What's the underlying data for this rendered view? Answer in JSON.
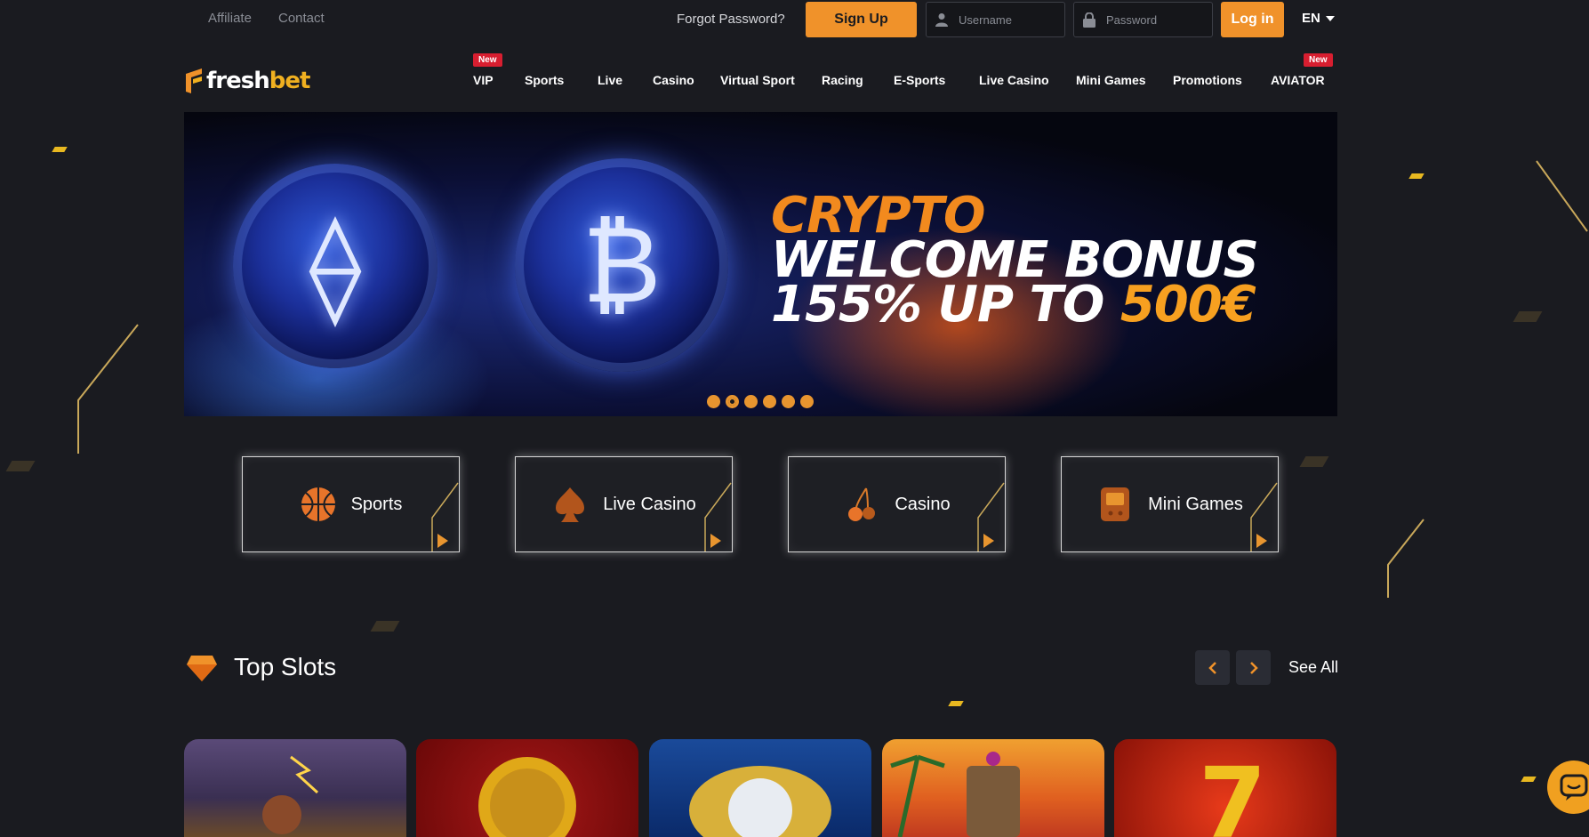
{
  "topbar": {
    "links": [
      "Affiliate",
      "Contact"
    ],
    "forgot_password": "Forgot Password?",
    "signup_label": "Sign Up",
    "username_placeholder": "Username",
    "password_placeholder": "Password",
    "login_label": "Log in",
    "language": "EN"
  },
  "logo": {
    "text_white": "fresh",
    "text_orange": "bet"
  },
  "nav": {
    "items": [
      "VIP",
      "Sports",
      "Live",
      "Casino",
      "Virtual Sport",
      "Racing",
      "E-Sports",
      "Live Casino",
      "Mini Games",
      "Promotions",
      "AVIATOR"
    ],
    "new_badge": "New"
  },
  "banner": {
    "line1": "CRYPTO",
    "line2": "WELCOME BONUS",
    "line3_prefix": "155% UP TO ",
    "line3_highlight": "500€",
    "slides": 6,
    "active_slide": 2,
    "coin_symbols": [
      "ethereum-symbol",
      "bitcoin-symbol"
    ]
  },
  "categories": [
    {
      "label": "Sports",
      "icon": "basketball-icon"
    },
    {
      "label": "Live Casino",
      "icon": "spade-icon"
    },
    {
      "label": "Casino",
      "icon": "cherry-icon"
    },
    {
      "label": "Mini Games",
      "icon": "game-console-icon"
    }
  ],
  "top_slots": {
    "title": "Top Slots",
    "see_all": "See All",
    "prev_icon": "chevron-left-icon",
    "next_icon": "chevron-right-icon"
  },
  "colors": {
    "background": "#1a1b20",
    "accent": "#f0922a",
    "badge_red": "#d81e30",
    "gold": "#f0b020"
  }
}
